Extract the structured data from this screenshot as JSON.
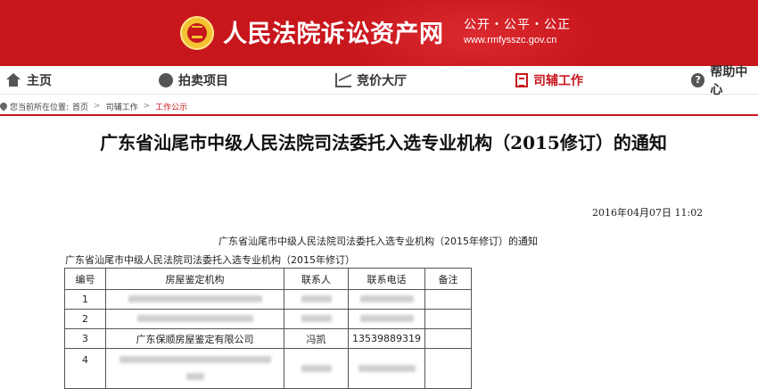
{
  "header": {
    "site_title": "人民法院诉讼资产网",
    "slogan": "公开・公平・公正",
    "domain": "www.rmfysszc.gov.cn",
    "emblem": "court-emblem-icon",
    "brand_color": "#c8161d"
  },
  "nav": {
    "items": [
      {
        "label": "主页",
        "icon": "home-icon"
      },
      {
        "label": "拍卖项目",
        "icon": "bag-icon"
      },
      {
        "label": "竞价大厅",
        "icon": "chart-icon"
      },
      {
        "label": "司辅工作",
        "icon": "document-icon",
        "active": true
      },
      {
        "label": "帮助中心",
        "icon": "help-icon"
      }
    ]
  },
  "breadcrumb": {
    "prefix": "您当前所在位置:",
    "items": [
      "首页",
      "司辅工作",
      "工作公示"
    ],
    "separator": ">"
  },
  "article": {
    "title": "广东省汕尾市中级人民法院司法委托入选专业机构（2015修订）的通知",
    "date": "2016年04月07日 11:02",
    "subtitle": "广东省汕尾市中级人民法院司法委托入选专业机构（2015年修订）的通知",
    "table_caption": "广东省汕尾市中级人民法院司法委托入选专业机构（2015年修订）",
    "table": {
      "headers": [
        "编号",
        "房屋鉴定机构",
        "联系人",
        "联系电话",
        "备注"
      ],
      "rows": [
        {
          "no": "1",
          "org": "",
          "contact": "",
          "phone": "",
          "note": ""
        },
        {
          "no": "2",
          "org": "",
          "contact": "",
          "phone": "",
          "note": ""
        },
        {
          "no": "3",
          "org": "广东保顺房屋鉴定有限公司",
          "contact": "冯凯",
          "phone": "13539889319",
          "note": ""
        },
        {
          "no": "4",
          "org": "",
          "contact": "",
          "phone": "",
          "note": ""
        }
      ]
    }
  }
}
